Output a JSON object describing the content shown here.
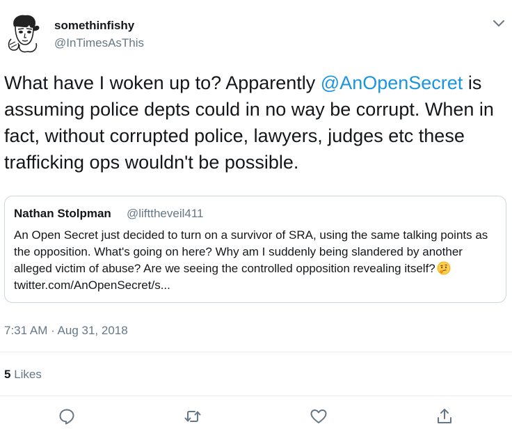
{
  "author": {
    "display_name": "somethinfishy",
    "handle": "@InTimesAsThis"
  },
  "tweet": {
    "text_before": "What have I woken up to? Apparently ",
    "mention": "@AnOpenSecret",
    "text_after": " is assuming police depts could in no way be corrupt. When in fact, without corrupted police, lawyers, judges etc these trafficking ops wouldn't be possible."
  },
  "quoted_tweet": {
    "display_name": "Nathan Stolpman",
    "handle": "@lifttheveil411",
    "text_before": "An Open Secret just decided to turn on a survivor of SRA, using the same talking points as the opposition. What's going on here? Why am I suddenly being slandered by another alleged victim of abuse? Are we seeing the controlled opposition revealing itself?",
    "emoji": "thinking-face-icon",
    "link": "twitter.com/AnOpenSecret/s..."
  },
  "meta": {
    "timestamp": "7:31 AM · Aug 31, 2018",
    "likes_count": "5",
    "likes_label": "Likes"
  },
  "actions": {
    "reply_icon": "reply-icon",
    "retweet_icon": "retweet-icon",
    "like_icon": "heart-icon",
    "share_icon": "share-icon"
  },
  "colors": {
    "mention": "#1b95e0",
    "secondary_text": "#657786",
    "border": "#ccd6dd",
    "divider": "#e6ecf0"
  }
}
